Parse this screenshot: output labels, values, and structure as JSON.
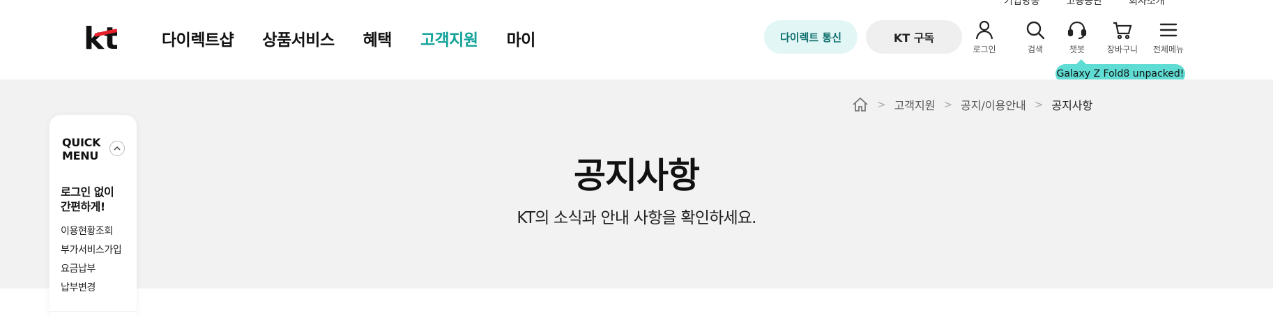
{
  "header": {
    "nav": [
      {
        "label": "다이렉트샵",
        "active": false
      },
      {
        "label": "상품서비스",
        "active": false
      },
      {
        "label": "혜택",
        "active": false
      },
      {
        "label": "고객지원",
        "active": true
      },
      {
        "label": "마이",
        "active": false
      }
    ],
    "util_top": [
      "기업방송",
      "고용공단",
      "회사소개"
    ],
    "pill_direct": "다이렉트 통신",
    "pill_subscribe": "KT 구독",
    "utils": [
      {
        "icon": "user-icon",
        "label": "로그인"
      },
      {
        "icon": "search-icon",
        "label": "검색"
      },
      {
        "icon": "headset-icon",
        "label": "챗봇"
      },
      {
        "icon": "cart-icon",
        "label": "장바구니"
      },
      {
        "icon": "menu-icon",
        "label": "전체메뉴"
      }
    ],
    "tooltip": "Galaxy Z Fold8 unpacked!"
  },
  "breadcrumb": {
    "home_icon": "home-icon",
    "items": [
      "고객지원",
      "공지/이용안내",
      "공지사항"
    ]
  },
  "page": {
    "title": "공지사항",
    "subtitle": "KT의 소식과 안내 사항을 확인하세요."
  },
  "quick_menu": {
    "title_line1": "QUICK",
    "title_line2": "MENU",
    "heading_line1": "로그인 없이",
    "heading_line2": "간편하게!",
    "items": [
      "이용현황조회",
      "부가서비스가입",
      "요금납부",
      "납부변경"
    ]
  },
  "colors": {
    "accent": "#13a39a",
    "banner_bg": "#f2f2f2",
    "tooltip_bg": "#5fdcd3",
    "logo_red": "#e8202a"
  }
}
